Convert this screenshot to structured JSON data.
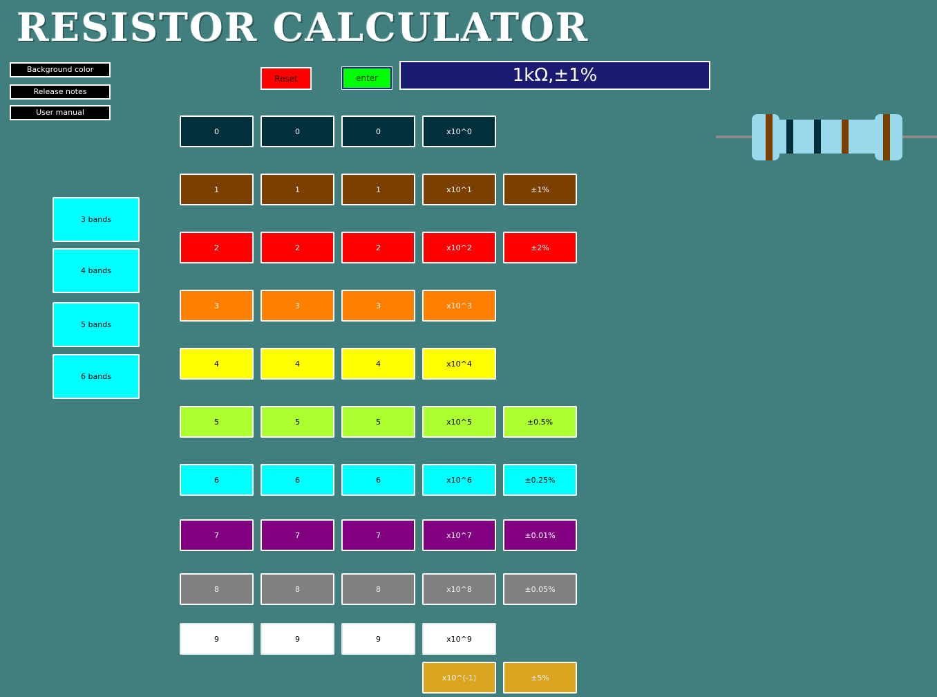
{
  "title": "RESISTOR CALCULATOR",
  "menu": {
    "background_color": "Background color",
    "release_notes": "Release notes",
    "user_manual": "User manual"
  },
  "band_modes": [
    "3 bands",
    "4 bands",
    "5 bands",
    "6 bands"
  ],
  "controls": {
    "reset": "Reset",
    "enter": "enter"
  },
  "result": "1kΩ,±1%",
  "colors": {
    "background": "#417f7e",
    "black": "#012f3c",
    "brown": "#7b3f00",
    "red": "#ff0000",
    "orange": "#ff7f00",
    "yellow": "#ffff00",
    "green": "#adff2f",
    "blue": "#00ffff",
    "violet": "#800080",
    "gray": "#808080",
    "white": "#ffffff",
    "gold": "#daa520",
    "resistor_body": "#9ad8ec"
  },
  "grid": [
    {
      "color": "black",
      "digits": [
        "0",
        "0",
        "0"
      ],
      "multiplier": "x10^0",
      "tolerance": null
    },
    {
      "color": "brown",
      "digits": [
        "1",
        "1",
        "1"
      ],
      "multiplier": "x10^1",
      "tolerance": "±1%"
    },
    {
      "color": "red",
      "digits": [
        "2",
        "2",
        "2"
      ],
      "multiplier": "x10^2",
      "tolerance": "±2%"
    },
    {
      "color": "orange",
      "digits": [
        "3",
        "3",
        "3"
      ],
      "multiplier": "x10^3",
      "tolerance": null
    },
    {
      "color": "yellow",
      "digits": [
        "4",
        "4",
        "4"
      ],
      "multiplier": "x10^4",
      "tolerance": null
    },
    {
      "color": "green",
      "digits": [
        "5",
        "5",
        "5"
      ],
      "multiplier": "x10^5",
      "tolerance": "±0.5%"
    },
    {
      "color": "blue",
      "digits": [
        "6",
        "6",
        "6"
      ],
      "multiplier": "x10^6",
      "tolerance": "±0.25%"
    },
    {
      "color": "violet",
      "digits": [
        "7",
        "7",
        "7"
      ],
      "multiplier": "x10^7",
      "tolerance": "±0.01%"
    },
    {
      "color": "gray",
      "digits": [
        "8",
        "8",
        "8"
      ],
      "multiplier": "x10^8",
      "tolerance": "±0.05%"
    },
    {
      "color": "white",
      "digits": [
        "9",
        "9",
        "9"
      ],
      "multiplier": "x10^9",
      "tolerance": null
    },
    {
      "color": "gold",
      "digits": [
        null,
        null,
        null
      ],
      "multiplier": "x10^(-1)",
      "tolerance": "±5%"
    }
  ],
  "resistor_bands": [
    "brown",
    "black",
    "black",
    "brown",
    "brown"
  ]
}
